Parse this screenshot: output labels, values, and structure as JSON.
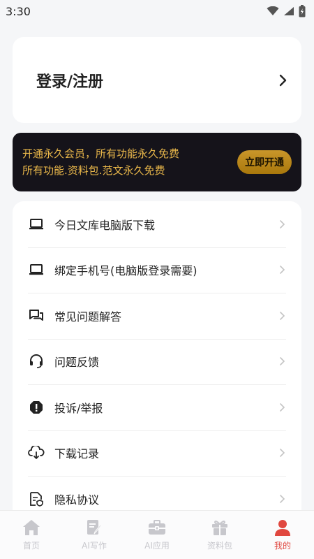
{
  "status_bar": {
    "time": "3:30",
    "icons": [
      "wifi-icon",
      "signal-icon",
      "battery-icon"
    ]
  },
  "login": {
    "title": "登录/注册"
  },
  "vip": {
    "line1": "开通永久会员，所有功能永久免费",
    "line2": "所有功能.资料包.范文永久免费",
    "button_label": "立即开通",
    "colors": {
      "card": "#15131a",
      "text": "#e9b74a",
      "button": "#b8860b"
    }
  },
  "menu": {
    "items": [
      {
        "label": "今日文库电脑版下载",
        "icon": "laptop-icon"
      },
      {
        "label": "绑定手机号(电脑版登录需要)",
        "icon": "laptop-icon"
      },
      {
        "label": "常见问题解答",
        "icon": "chat-icon"
      },
      {
        "label": "问题反馈",
        "icon": "headset-icon"
      },
      {
        "label": "投诉/举报",
        "icon": "alert-icon"
      },
      {
        "label": "下载记录",
        "icon": "cloud-download-icon"
      },
      {
        "label": "隐私协议",
        "icon": "document-icon"
      }
    ]
  },
  "tabbar": {
    "tabs": [
      {
        "label": "首页",
        "icon": "home-icon",
        "active": false
      },
      {
        "label": "AI写作",
        "icon": "write-icon",
        "active": false
      },
      {
        "label": "AI应用",
        "icon": "briefcase-icon",
        "active": false
      },
      {
        "label": "资料包",
        "icon": "gift-icon",
        "active": false
      },
      {
        "label": "我的",
        "icon": "user-icon",
        "active": true
      }
    ],
    "colors": {
      "inactive": "#c7c7cc",
      "active": "#e0473f"
    }
  }
}
